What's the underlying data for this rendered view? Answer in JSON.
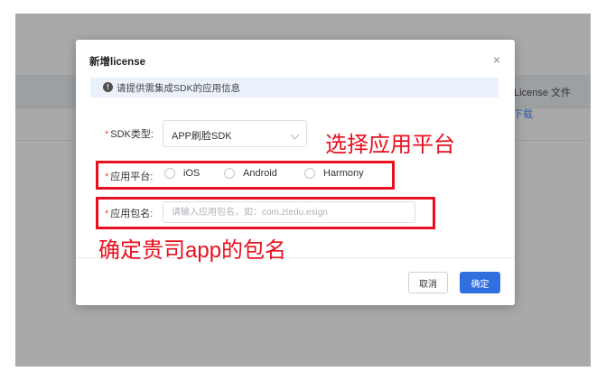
{
  "background": {
    "column_header": "License 文件",
    "row_link": "下载"
  },
  "dialog": {
    "title": "新增license",
    "close_glyph": "×",
    "notice": {
      "icon": "info-icon",
      "text": "请提供需集成SDK的应用信息"
    },
    "sdk_type": {
      "label": "SDK类型:",
      "value": "APP刷脸SDK"
    },
    "platform": {
      "label": "应用平台:",
      "options": [
        "iOS",
        "Android",
        "Harmony"
      ]
    },
    "package_name": {
      "label": "应用包名:",
      "placeholder": "请输入应用包名，如：com.ztedu.esign",
      "value": ""
    },
    "buttons": {
      "cancel": "取消",
      "confirm": "确定"
    }
  },
  "annotations": {
    "platform_note": "选择应用平台",
    "package_note": "确定贵司app的包名"
  },
  "colors": {
    "annotation_red": "#e8101f",
    "primary_blue": "#2f6fe0",
    "required_star": "#e74c3c",
    "notice_bg": "#ebf1fb"
  }
}
